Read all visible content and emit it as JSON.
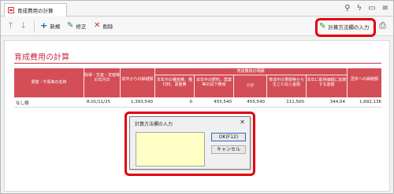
{
  "tab": {
    "title": "育成費用の計算"
  },
  "titlebar_icons": [
    "search-icon",
    "bolt-icon",
    "window-icon",
    "menu-icon"
  ],
  "toolbar": {
    "new_label": "新規",
    "edit_label": "修正",
    "delete_label": "削除",
    "calc_method_label": "計算方法欄の入力"
  },
  "page": {
    "title": "育成費用の計算"
  },
  "table": {
    "headers": {
      "col1": "果樹・牛馬等の名称",
      "col2": "取得・生産・定植等の年月日",
      "col3": "前年からの繰越額",
      "group": "育成費用の明細",
      "col4": "本年中の種苗費、種付料、素畜費",
      "col5": "本年中の肥料、農薬等の投下費用",
      "col6": "小計",
      "col7": "育成中の果樹等から生じた収入金額",
      "col8": "本年に取得価額に加算する金額",
      "col9": "翌年への繰越額"
    },
    "rows": [
      {
        "name": "なし樹",
        "date": "R.01/11/25",
        "carryover": "1,393,540",
        "seed": "0",
        "fert": "455,540",
        "subtotal": "455,540",
        "income": "111,500",
        "add": "344,04",
        "next": "1,692,136"
      }
    ]
  },
  "dialog": {
    "title": "計算方法欄の入力",
    "input_value": "",
    "ok_label": "OK(F12)",
    "cancel_label": "キャンセル"
  },
  "colors": {
    "accent": "#d34e56",
    "highlight": "#e0000b",
    "input_bg": "#ffffc6"
  }
}
